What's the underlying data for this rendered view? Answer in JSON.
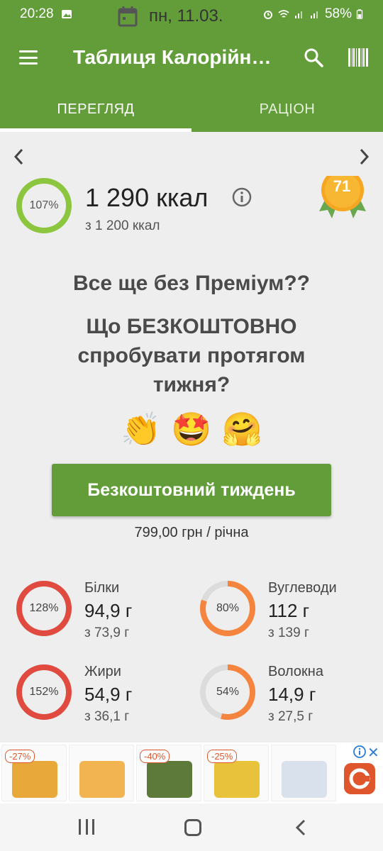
{
  "status_bar": {
    "time": "20:28",
    "battery": "58%"
  },
  "toolbar": {
    "title": "Таблиця Калорійн…",
    "menu_icon": "hamburger-icon",
    "search_icon": "search-icon",
    "barcode_icon": "barcode-icon"
  },
  "tabs": [
    {
      "label": "ПЕРЕГЛЯД",
      "active": true
    },
    {
      "label": "РАЦІОН",
      "active": false
    }
  ],
  "date_nav": {
    "date": "пн, 11.03."
  },
  "calories": {
    "percent": "107%",
    "percent_value": 107,
    "value": "1 290 ккал",
    "goal": "з 1 200 ккал",
    "medal_number": "71"
  },
  "promo": {
    "title": "Все ще без Преміум??",
    "subtitle": "Що БЕЗКОШТОВНО спробувати протягом тижня?",
    "emojis": [
      "👏",
      "🤩",
      "🤗"
    ],
    "button_label": "Безкоштовний тиждень",
    "price": "799,00 грн / річна"
  },
  "macros": [
    {
      "name": "Білки",
      "percent": "128%",
      "percent_value": 128,
      "value": "94,9 г",
      "goal": "з 73,9 г",
      "color": "#e04a3f"
    },
    {
      "name": "Вуглеводи",
      "percent": "80%",
      "percent_value": 80,
      "value": "112 г",
      "goal": "з 139 г",
      "color": "#f5843f"
    },
    {
      "name": "Жири",
      "percent": "152%",
      "percent_value": 152,
      "value": "54,9 г",
      "goal": "з 36,1 г",
      "color": "#e04a3f"
    },
    {
      "name": "Волокна",
      "percent": "54%",
      "percent_value": 54,
      "value": "14,9 г",
      "goal": "з 27,5 г",
      "color": "#f5843f"
    }
  ],
  "ad": {
    "items": [
      {
        "badge": "-27%"
      },
      {
        "badge": ""
      },
      {
        "badge": "-40%"
      },
      {
        "badge": "-25%"
      },
      {
        "badge": ""
      }
    ]
  },
  "colors": {
    "primary": "#629d3a",
    "ring_green": "#8cc63f",
    "medal": "#f5a623"
  }
}
